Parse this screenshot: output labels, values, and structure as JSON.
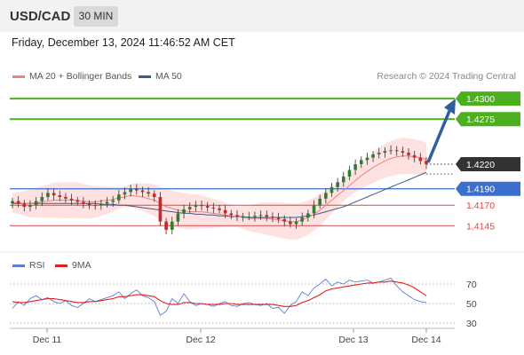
{
  "header": {
    "symbol": "USD/CAD",
    "timeframe": "30 MIN"
  },
  "timestamp": "Friday, December 13, 2024 11:46:52 AM CET",
  "credit": "Research © 2024 Trading Central",
  "colors": {
    "resistance": "#4caf1e",
    "support": "#d94a4a",
    "blue_level": "#3a6fd0",
    "current": "#333333",
    "arrow": "#2f5f9f",
    "bb": "#fdd7d7",
    "ma20": "#f08080",
    "ma50": "#3d5a8a",
    "candle_up": "#2e7d32",
    "candle_down": "#c62828",
    "rsi": "#5b7fd6",
    "rsi_ma": "#e02020"
  },
  "chart_data": [
    {
      "type": "candlestick",
      "legend": [
        {
          "name": "MA 20 + Bollinger Bands",
          "color": "#f08080"
        },
        {
          "name": "MA 50",
          "color": "#3d5a8a"
        }
      ],
      "ylim": [
        1.4115,
        1.4325
      ],
      "x_ticks": [
        "Dec 11",
        "Dec 12",
        "Dec 13",
        "Dec 14"
      ],
      "levels": [
        {
          "value": 1.43,
          "label": "1.4300",
          "kind": "resistance"
        },
        {
          "value": 1.4275,
          "label": "1.4275",
          "kind": "resistance"
        },
        {
          "value": 1.422,
          "label": "1.4220",
          "kind": "current"
        },
        {
          "value": 1.419,
          "label": "1.4190",
          "kind": "pivot"
        },
        {
          "value": 1.417,
          "label": "1.4170",
          "kind": "support"
        },
        {
          "value": 1.4145,
          "label": "1.4145",
          "kind": "support"
        }
      ],
      "close": [
        1.4175,
        1.4172,
        1.4168,
        1.417,
        1.4175,
        1.418,
        1.4185,
        1.4182,
        1.418,
        1.4178,
        1.4176,
        1.4174,
        1.4172,
        1.417,
        1.417,
        1.4172,
        1.4174,
        1.4176,
        1.4183,
        1.4186,
        1.419,
        1.4188,
        1.4186,
        1.4184,
        1.418,
        1.415,
        1.414,
        1.415,
        1.416,
        1.4165,
        1.4168,
        1.417,
        1.4169,
        1.4167,
        1.4166,
        1.4164,
        1.416,
        1.4158,
        1.4156,
        1.4156,
        1.4156,
        1.4157,
        1.4158,
        1.4156,
        1.4155,
        1.4153,
        1.415,
        1.4147,
        1.415,
        1.4155,
        1.416,
        1.417,
        1.4178,
        1.4185,
        1.4192,
        1.4198,
        1.4205,
        1.4213,
        1.422,
        1.4225,
        1.4228,
        1.4232,
        1.4234,
        1.4236,
        1.4237,
        1.4236,
        1.4234,
        1.4231,
        1.4228,
        1.4224,
        1.422
      ],
      "ma20": [
        1.4173,
        1.4173,
        1.4172,
        1.4172,
        1.4173,
        1.4174,
        1.4175,
        1.4176,
        1.4176,
        1.4176,
        1.4176,
        1.4176,
        1.4175,
        1.4174,
        1.4174,
        1.4175,
        1.4176,
        1.4177,
        1.4179,
        1.418,
        1.4182,
        1.4181,
        1.418,
        1.4178,
        1.4176,
        1.4172,
        1.4168,
        1.4166,
        1.4164,
        1.4163,
        1.4162,
        1.4162,
        1.4162,
        1.4161,
        1.416,
        1.4159,
        1.4158,
        1.4157,
        1.4156,
        1.4155,
        1.4154,
        1.4154,
        1.4154,
        1.4154,
        1.4153,
        1.4152,
        1.4151,
        1.415,
        1.415,
        1.4152,
        1.4155,
        1.4159,
        1.4164,
        1.417,
        1.4176,
        1.4182,
        1.4188,
        1.4194,
        1.42,
        1.4206,
        1.4211,
        1.4216,
        1.422,
        1.4224,
        1.4227,
        1.4229,
        1.423,
        1.423,
        1.4229,
        1.4228,
        1.4226
      ],
      "ma50": [
        1.4172,
        1.4172,
        1.4172,
        1.4172,
        1.4172,
        1.4172,
        1.4172,
        1.4172,
        1.4172,
        1.4172,
        1.4172,
        1.4172,
        1.4172,
        1.4172,
        1.4172,
        1.4171,
        1.4171,
        1.4171,
        1.417,
        1.417,
        1.4169,
        1.4168,
        1.4167,
        1.4166,
        1.4165,
        1.4164,
        1.4163,
        1.4162,
        1.4161,
        1.416,
        1.416,
        1.4159,
        1.4159,
        1.4158,
        1.4158,
        1.4157,
        1.4157,
        1.4156,
        1.4156,
        1.4156,
        1.4155,
        1.4155,
        1.4155,
        1.4155,
        1.4155,
        1.4155,
        1.4155,
        1.4155,
        1.4155,
        1.4156,
        1.4157,
        1.4158,
        1.416,
        1.4162,
        1.4164,
        1.4166,
        1.4168,
        1.4171,
        1.4174,
        1.4177,
        1.418,
        1.4183,
        1.4186,
        1.4189,
        1.4192,
        1.4195,
        1.4198,
        1.4201,
        1.4204,
        1.4207,
        1.421
      ],
      "forecast_target": 1.43
    },
    {
      "type": "line",
      "legend": [
        {
          "name": "RSI",
          "color": "#5b7fd6"
        },
        {
          "name": "9MA",
          "color": "#e02020"
        }
      ],
      "ylim": [
        20,
        80
      ],
      "y_ticks": [
        70,
        50,
        30
      ],
      "rsi": [
        45,
        52,
        48,
        55,
        58,
        54,
        56,
        52,
        50,
        53,
        48,
        46,
        50,
        55,
        52,
        54,
        56,
        58,
        62,
        55,
        60,
        64,
        58,
        56,
        52,
        38,
        42,
        55,
        50,
        60,
        52,
        48,
        50,
        49,
        47,
        50,
        52,
        48,
        47,
        50,
        51,
        49,
        48,
        50,
        45,
        46,
        40,
        48,
        52,
        62,
        58,
        66,
        70,
        75,
        68,
        72,
        70,
        74,
        72,
        73,
        74,
        71,
        72,
        74,
        76,
        68,
        62,
        58,
        54,
        52,
        51
      ],
      "rsi_ma": [
        52,
        51,
        51,
        52,
        53,
        54,
        55,
        55,
        54,
        53,
        52,
        51,
        51,
        52,
        52,
        53,
        54,
        55,
        57,
        57,
        58,
        59,
        59,
        58,
        57,
        53,
        50,
        49,
        49,
        51,
        51,
        50,
        50,
        49,
        49,
        49,
        50,
        50,
        49,
        49,
        49,
        49,
        49,
        49,
        49,
        48,
        47,
        47,
        48,
        51,
        53,
        56,
        59,
        63,
        65,
        66,
        67,
        68,
        69,
        70,
        71,
        71,
        72,
        72,
        73,
        72,
        71,
        69,
        66,
        62,
        58
      ]
    }
  ]
}
